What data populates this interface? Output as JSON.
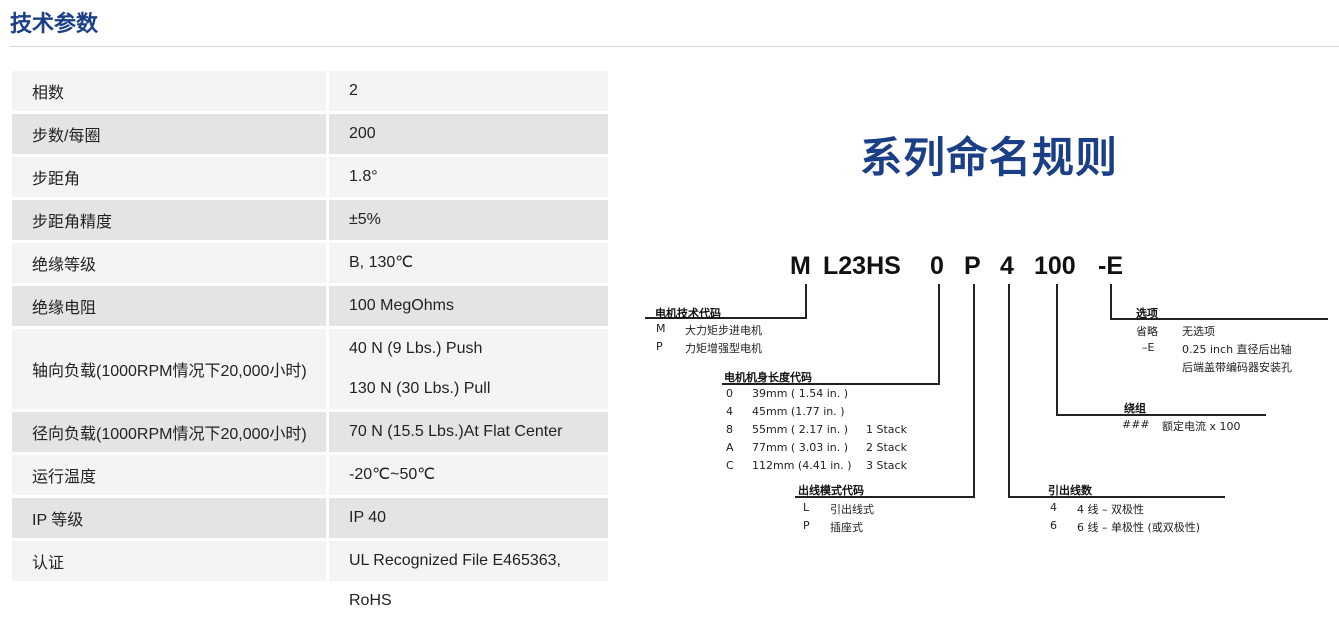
{
  "page_title": "技术参数",
  "specs": [
    {
      "label": "相数",
      "values": [
        "2"
      ]
    },
    {
      "label": "步数/每圈",
      "values": [
        "200"
      ]
    },
    {
      "label": "步距角",
      "values": [
        "1.8°"
      ]
    },
    {
      "label": "步距角精度",
      "values": [
        "±5%"
      ]
    },
    {
      "label": "绝缘等级",
      "values": [
        "B, 130℃"
      ]
    },
    {
      "label": "绝缘电阻",
      "values": [
        "100 MegOhms"
      ]
    },
    {
      "label": "轴向负载(1000RPM情况下20,000小时)",
      "values": [
        "40 N (9 Lbs.) Push",
        "130 N (30 Lbs.) Pull"
      ]
    },
    {
      "label": "径向负载(1000RPM情况下20,000小时)",
      "values": [
        "70 N (15.5 Lbs.)At Flat Center"
      ]
    },
    {
      "label": "运行温度",
      "values": [
        "-20℃~50℃"
      ]
    },
    {
      "label": "IP 等级",
      "values": [
        "IP 40"
      ]
    },
    {
      "label": "认证",
      "values": [
        "UL Recognized File E465363, RoHS"
      ]
    }
  ],
  "naming": {
    "title": "系列命名规则",
    "code_parts": [
      "M",
      "L23HS",
      "0",
      "P",
      "4",
      "100",
      "-E"
    ],
    "groups": {
      "tech_code": {
        "title": "电机技术代码",
        "rows": [
          [
            "M",
            "大力矩步进电机"
          ],
          [
            "P",
            "力矩增强型电机"
          ]
        ]
      },
      "length_code": {
        "title": "电机机身长度代码",
        "rows": [
          [
            "0",
            "39mm ( 1.54 in. )",
            ""
          ],
          [
            "4",
            "45mm (1.77 in. )",
            ""
          ],
          [
            "8",
            "55mm ( 2.17 in. )",
            "1 Stack"
          ],
          [
            "A",
            "77mm ( 3.03 in. )",
            "2 Stack"
          ],
          [
            "C",
            "112mm (4.41 in. )",
            "3 Stack"
          ]
        ]
      },
      "lead_mode": {
        "title": "出线模式代码",
        "rows": [
          [
            "L",
            "引出线式"
          ],
          [
            "P",
            "插座式"
          ]
        ]
      },
      "options": {
        "title": "选项",
        "rows": [
          [
            "省略",
            "无选项"
          ],
          [
            "–E",
            "0.25 inch 直径后出轴"
          ],
          [
            "",
            "后端盖带编码器安装孔"
          ]
        ]
      },
      "winding": {
        "title": "绕组",
        "rows": [
          [
            "###",
            "额定电流 x 100"
          ]
        ]
      },
      "lead_count": {
        "title": "引出线数",
        "rows": [
          [
            "4",
            "4 线 – 双极性"
          ],
          [
            "6",
            "6 线 – 单极性 (或双极性)"
          ]
        ]
      }
    }
  }
}
